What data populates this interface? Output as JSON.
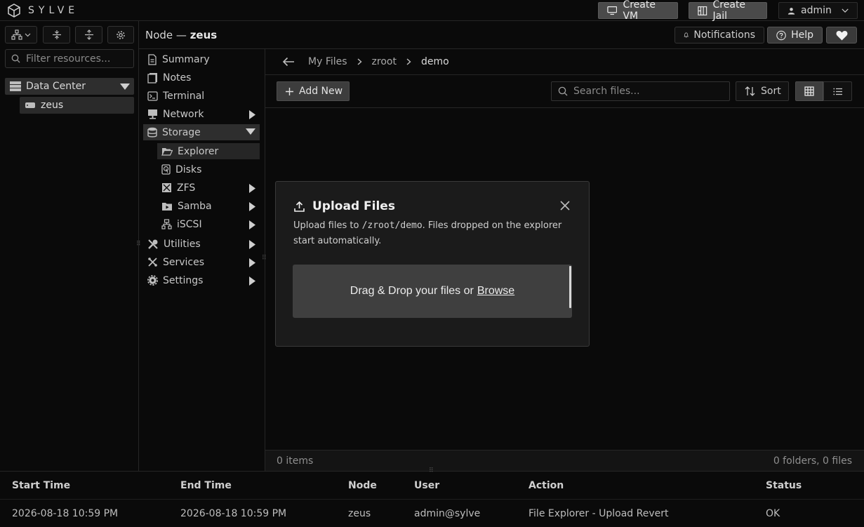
{
  "app": {
    "logo_text": "SYLVE"
  },
  "topbar": {
    "create_vm": "Create VM",
    "create_jail": "Create Jail",
    "user": "admin"
  },
  "resources": {
    "filter_placeholder": "Filter resources...",
    "tree": {
      "datacenter": "Data Center",
      "node": "zeus"
    }
  },
  "node_header": {
    "prefix": "Node —",
    "name": "zeus",
    "notifications": "Notifications",
    "help": "Help"
  },
  "nav": {
    "items": [
      {
        "label": "Summary",
        "icon": "file-icon"
      },
      {
        "label": "Notes",
        "icon": "notes-icon"
      },
      {
        "label": "Terminal",
        "icon": "terminal-icon"
      },
      {
        "label": "Network",
        "icon": "network-icon"
      },
      {
        "label": "Storage",
        "icon": "database-icon"
      },
      {
        "label": "Explorer",
        "icon": "folder-open-icon"
      },
      {
        "label": "Disks",
        "icon": "disk-icon"
      },
      {
        "label": "ZFS",
        "icon": "zfs-icon"
      },
      {
        "label": "Samba",
        "icon": "samba-icon"
      },
      {
        "label": "iSCSI",
        "icon": "iscsi-icon"
      },
      {
        "label": "Utilities",
        "icon": "tools-icon"
      },
      {
        "label": "Services",
        "icon": "services-icon"
      },
      {
        "label": "Settings",
        "icon": "gear-icon"
      }
    ]
  },
  "breadcrumb": {
    "items": [
      "My Files",
      "zroot",
      "demo"
    ]
  },
  "toolbar": {
    "add_new": "Add New",
    "search_placeholder": "Search files...",
    "sort": "Sort",
    "view_mode": "grid"
  },
  "status": {
    "items": "0 items",
    "summary": "0 folders, 0 files"
  },
  "log": {
    "headers": [
      "Start Time",
      "End Time",
      "Node",
      "User",
      "Action",
      "Status"
    ],
    "rows": [
      [
        "2026-08-18 10:59 PM",
        "2026-08-18 10:59 PM",
        "zeus",
        "admin@sylve",
        "File Explorer - Upload Revert",
        "OK"
      ]
    ]
  },
  "modal": {
    "title": "Upload Files",
    "desc_before": "Upload files to ",
    "desc_path": "/zroot/demo",
    "desc_after": ". Files dropped on the explorer start automatically.",
    "dropzone_text": "Drag & Drop your files or",
    "browse": "Browse"
  },
  "colors": {
    "background": "#0a0a0a",
    "panel": "#1b1b1b",
    "button": "#4a4a4a",
    "dropzone": "#3f3f3f"
  }
}
